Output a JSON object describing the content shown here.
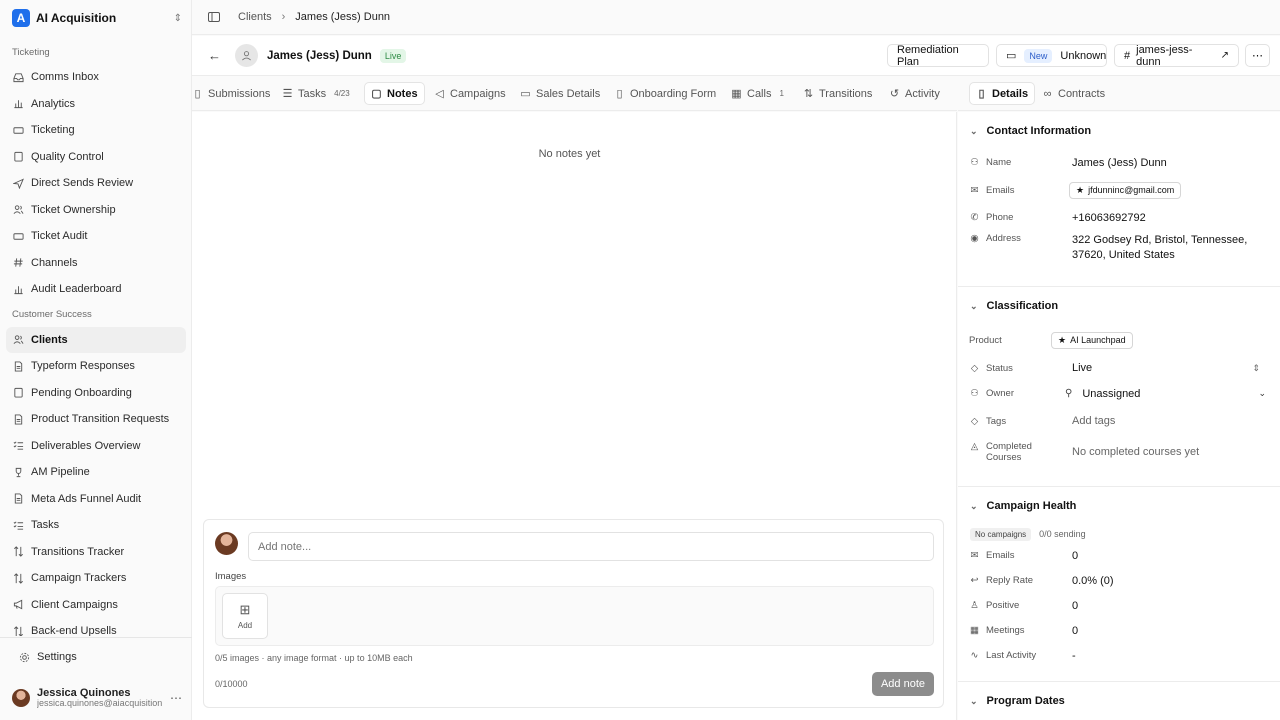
{
  "org": {
    "name": "AI Acquisition",
    "logo_letter": "A"
  },
  "sidebar": {
    "sections": [
      {
        "title": "Ticketing",
        "items": [
          {
            "label": "Comms Inbox",
            "icon": "inbox-icon"
          },
          {
            "label": "Analytics",
            "icon": "chart-icon"
          },
          {
            "label": "Ticketing",
            "icon": "ticket-icon"
          },
          {
            "label": "Quality Control",
            "icon": "clipboard-icon"
          },
          {
            "label": "Direct Sends Review",
            "icon": "send-icon"
          },
          {
            "label": "Ticket Ownership",
            "icon": "users-icon"
          },
          {
            "label": "Ticket Audit",
            "icon": "ticket-icon"
          },
          {
            "label": "Channels",
            "icon": "hash-icon"
          },
          {
            "label": "Audit Leaderboard",
            "icon": "chart-icon"
          }
        ]
      },
      {
        "title": "Customer Success",
        "items": [
          {
            "label": "Clients",
            "icon": "users-icon",
            "active": true
          },
          {
            "label": "Typeform Responses",
            "icon": "file-icon"
          },
          {
            "label": "Pending Onboarding",
            "icon": "clipboard-icon"
          },
          {
            "label": "Product Transition Requests",
            "icon": "file-icon"
          },
          {
            "label": "Deliverables Overview",
            "icon": "list-check-icon"
          },
          {
            "label": "AM Pipeline",
            "icon": "trophy-icon"
          },
          {
            "label": "Meta Ads Funnel Audit",
            "icon": "file-icon"
          },
          {
            "label": "Tasks",
            "icon": "list-check-icon"
          },
          {
            "label": "Transitions Tracker",
            "icon": "arrows-icon"
          },
          {
            "label": "Campaign Trackers",
            "icon": "arrows-icon"
          },
          {
            "label": "Client Campaigns",
            "icon": "megaphone-icon"
          },
          {
            "label": "Back-end Upsells",
            "icon": "arrows-icon"
          }
        ]
      }
    ],
    "settings_label": "Settings",
    "user": {
      "name": "Jessica Quinones",
      "email": "jessica.quinones@aiacquisition.com"
    }
  },
  "breadcrumb": {
    "parent": "Clients",
    "current": "James (Jess) Dunn"
  },
  "header": {
    "name": "James (Jess) Dunn",
    "status_badge": "Live",
    "remediation_label": "Remediation Plan",
    "new_badge": "New",
    "unknown_label": "Unknown",
    "slug_label": "james-jess-dunn"
  },
  "tabs": [
    {
      "label": "Submissions",
      "icon": "file-icon"
    },
    {
      "label": "Tasks",
      "icon": "list-check-icon",
      "count": "4/23"
    },
    {
      "label": "Notes",
      "icon": "note-icon",
      "active": true
    },
    {
      "label": "Campaigns",
      "icon": "megaphone-icon"
    },
    {
      "label": "Sales Details",
      "icon": "message-icon"
    },
    {
      "label": "Onboarding Form",
      "icon": "file-icon"
    },
    {
      "label": "Calls",
      "icon": "calendar-icon",
      "count": "1"
    },
    {
      "label": "Transitions",
      "icon": "arrows-icon"
    },
    {
      "label": "Activity",
      "icon": "history-icon"
    }
  ],
  "right_tabs": [
    {
      "label": "Details",
      "icon": "file-icon",
      "active": true
    },
    {
      "label": "Contracts",
      "icon": "link-icon"
    }
  ],
  "notes": {
    "empty_text": "No notes yet",
    "input_placeholder": "Add note...",
    "images_label": "Images",
    "add_image_label": "Add",
    "images_hint": "0/5 images · any image format · up to 10MB each",
    "char_count": "0/10000",
    "add_button": "Add note"
  },
  "contact": {
    "title": "Contact Information",
    "name_label": "Name",
    "name_value": "James (Jess) Dunn",
    "emails_label": "Emails",
    "email_value": "jfdunninc@gmail.com",
    "phone_label": "Phone",
    "phone_value": "+16063692792",
    "address_label": "Address",
    "address_line1": "322 Godsey Rd, Bristol, Tennessee,",
    "address_line2": "37620, United States"
  },
  "classification": {
    "title": "Classification",
    "product_label": "Product",
    "product_value": "AI Launchpad",
    "status_label": "Status",
    "status_value": "Live",
    "owner_label": "Owner",
    "owner_value": "Unassigned",
    "tags_label": "Tags",
    "tags_placeholder": "Add tags",
    "courses_label_1": "Completed",
    "courses_label_2": "Courses",
    "courses_value": "No completed courses yet"
  },
  "campaign_health": {
    "title": "Campaign Health",
    "badge": "No campaigns",
    "sending": "0/0 sending",
    "emails_label": "Emails",
    "emails_value": "0",
    "reply_label": "Reply Rate",
    "reply_value": "0.0% (0)",
    "positive_label": "Positive",
    "positive_value": "0",
    "meetings_label": "Meetings",
    "meetings_value": "0",
    "last_label": "Last Activity",
    "last_value": "-"
  },
  "program_dates": {
    "title": "Program Dates"
  }
}
